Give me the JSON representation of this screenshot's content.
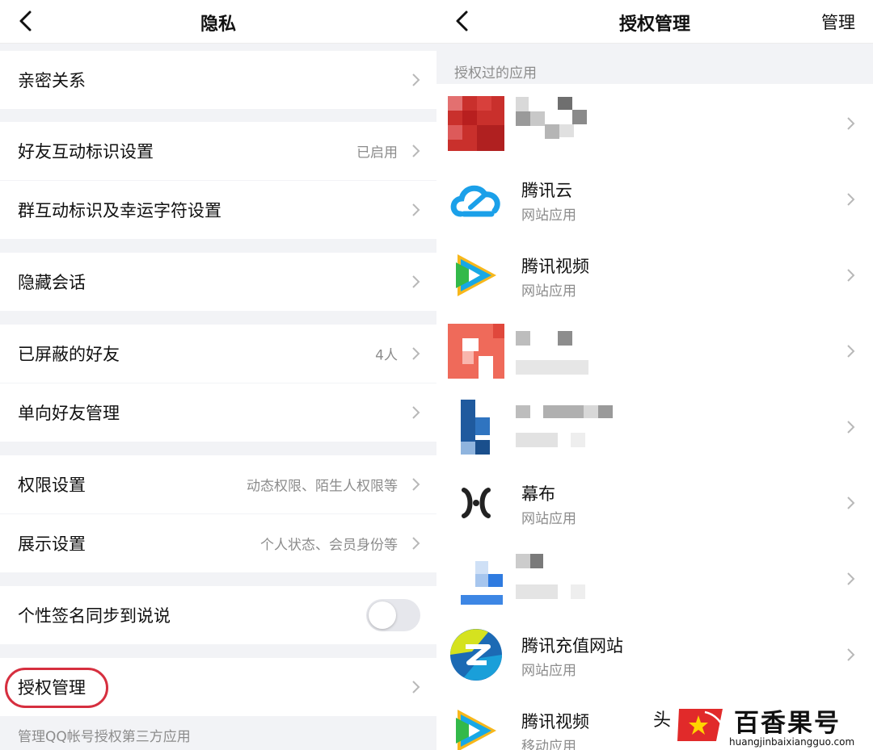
{
  "left": {
    "title": "隐私",
    "rows": [
      {
        "label": "亲密关系",
        "value": ""
      },
      {
        "label": "好友互动标识设置",
        "value": "已启用"
      },
      {
        "label": "群互动标识及幸运字符设置",
        "value": ""
      },
      {
        "label": "隐藏会话",
        "value": ""
      },
      {
        "label": "已屏蔽的好友",
        "value": "4人"
      },
      {
        "label": "单向好友管理",
        "value": ""
      },
      {
        "label": "权限设置",
        "value": "动态权限、陌生人权限等"
      },
      {
        "label": "展示设置",
        "value": "个人状态、会员身份等"
      },
      {
        "label": "个性签名同步到说说",
        "value": ""
      },
      {
        "label": "授权管理",
        "value": ""
      }
    ],
    "toggle_signature_sync": "off",
    "footnote": "管理QQ帐号授权第三方应用"
  },
  "right": {
    "title": "授权管理",
    "manage_label": "管理",
    "section_label": "授权过的应用",
    "apps": [
      {
        "name": "",
        "type": ""
      },
      {
        "name": "腾讯云",
        "type": "网站应用"
      },
      {
        "name": "腾讯视频",
        "type": "网站应用"
      },
      {
        "name": "",
        "type": ""
      },
      {
        "name": "",
        "type": ""
      },
      {
        "name": "幕布",
        "type": "网站应用"
      },
      {
        "name": "",
        "type": ""
      },
      {
        "name": "腾讯充值网站",
        "type": "网站应用"
      },
      {
        "name": "腾讯视频",
        "type": "移动应用"
      }
    ]
  },
  "watermark": {
    "partial_char": "头",
    "brand": "百香果号",
    "url": "huangjinbaixiangguo.com"
  },
  "colors": {
    "highlight_ring": "#d62f3f",
    "group_bg": "#f2f3f6",
    "secondary_text": "#8c8c8c",
    "watermark_red": "#e12a2a"
  }
}
